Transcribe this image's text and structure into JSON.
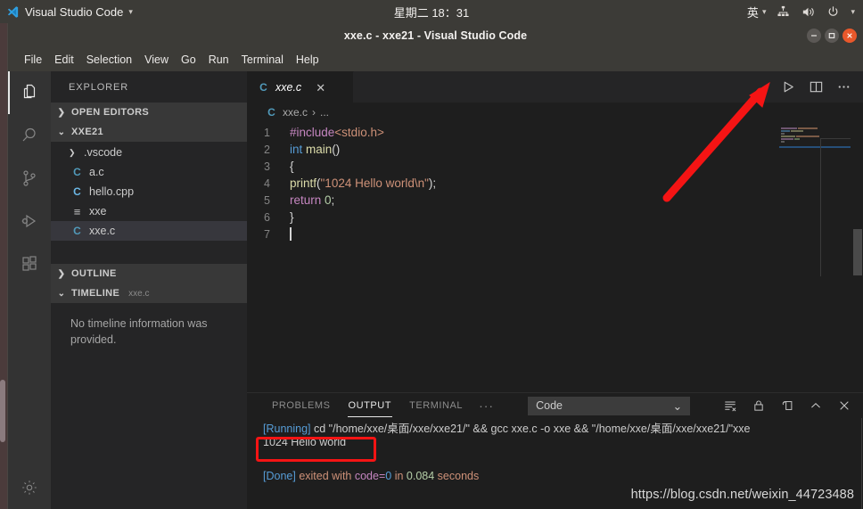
{
  "os_panel": {
    "app_name": "Visual Studio Code",
    "app_menu_caret": "▾",
    "clock": "星期二 18：31",
    "ime": "英",
    "ime_caret": "▾",
    "system_caret": "▾",
    "icons": [
      "vscode-logo-icon",
      "network-icon",
      "volume-icon",
      "power-icon"
    ]
  },
  "window": {
    "title": "xxe.c - xxe21 - Visual Studio Code",
    "controls": {
      "minimize": "minimize-button",
      "maximize": "maximize-button",
      "close": "close-button"
    }
  },
  "menubar": {
    "items": [
      "File",
      "Edit",
      "Selection",
      "View",
      "Go",
      "Run",
      "Terminal",
      "Help"
    ]
  },
  "activitybar": {
    "items": [
      {
        "name": "explorer",
        "icon": "files-icon",
        "active": true
      },
      {
        "name": "search",
        "icon": "search-icon",
        "active": false
      },
      {
        "name": "source-control",
        "icon": "source-control-icon",
        "active": false
      },
      {
        "name": "run-and-debug",
        "icon": "run-debug-icon",
        "active": false
      },
      {
        "name": "extensions",
        "icon": "extensions-icon",
        "active": false
      }
    ],
    "bottom": {
      "name": "manage",
      "icon": "gear-icon"
    }
  },
  "sidebar": {
    "title": "EXPLORER",
    "sections": [
      {
        "label": "OPEN EDITORS",
        "expanded": false,
        "twisty": "❯"
      },
      {
        "label": "XXE21",
        "expanded": true,
        "twisty": "⌄"
      }
    ],
    "tree": [
      {
        "label": ".vscode",
        "kind": "folder",
        "icon": "chevron-right-icon",
        "chev": "❯",
        "badge": "",
        "selected": false
      },
      {
        "label": "a.c",
        "kind": "file",
        "icon": "c-file-icon",
        "badge": "C",
        "selected": false
      },
      {
        "label": "hello.cpp",
        "kind": "file",
        "icon": "cpp-file-icon",
        "badge": "C",
        "selected": false
      },
      {
        "label": "xxe",
        "kind": "file",
        "icon": "binary-file-icon",
        "badge": "≡",
        "selected": false
      },
      {
        "label": "xxe.c",
        "kind": "file",
        "icon": "c-file-icon",
        "badge": "C",
        "selected": true
      }
    ],
    "outline": {
      "label": "OUTLINE",
      "twisty": "❯"
    },
    "timeline": {
      "label": "TIMELINE",
      "twisty": "⌄",
      "sub": "xxe.c",
      "empty_text": "No timeline information was provided."
    }
  },
  "editor": {
    "tab": {
      "label": "xxe.c",
      "badge": "C",
      "close": "✕"
    },
    "actions": [
      "run-code-icon",
      "split-editor-icon",
      "more-actions-icon"
    ],
    "breadcrumb": {
      "badge": "C",
      "file": "xxe.c",
      "sep": "›",
      "rest": "..."
    },
    "lines": [
      {
        "num": "1",
        "tokens": [
          {
            "t": "#include",
            "c": "t-pre"
          },
          {
            "t": "<stdio.h>",
            "c": "t-inc"
          }
        ]
      },
      {
        "num": "2",
        "tokens": [
          {
            "t": "int ",
            "c": "t-kw"
          },
          {
            "t": "main",
            "c": "t-fn"
          },
          {
            "t": "()",
            "c": "t-pun"
          }
        ]
      },
      {
        "num": "3",
        "tokens": [
          {
            "t": "{",
            "c": "t-pun"
          }
        ]
      },
      {
        "num": "4",
        "tokens": [
          {
            "t": "printf",
            "c": "t-fn"
          },
          {
            "t": "(",
            "c": "t-pun"
          },
          {
            "t": "\"1024 Hello world\\n\"",
            "c": "t-str"
          },
          {
            "t": ");",
            "c": "t-pun"
          }
        ]
      },
      {
        "num": "5",
        "tokens": [
          {
            "t": "return ",
            "c": "t-ctl"
          },
          {
            "t": "0",
            "c": "t-num"
          },
          {
            "t": ";",
            "c": "t-pun"
          }
        ]
      },
      {
        "num": "6",
        "tokens": [
          {
            "t": "}",
            "c": "t-pun"
          }
        ]
      },
      {
        "num": "7",
        "tokens": []
      }
    ]
  },
  "panel": {
    "tabs": [
      {
        "label": "PROBLEMS",
        "active": false
      },
      {
        "label": "OUTPUT",
        "active": true
      },
      {
        "label": "TERMINAL",
        "active": false
      },
      {
        "label": "···",
        "active": false,
        "dots": true
      }
    ],
    "channel": {
      "value": "Code",
      "caret": "⌄"
    },
    "actions": [
      "clear-output-icon",
      "lock-icon",
      "open-new-window-icon",
      "chevron-up-icon",
      "close-panel-icon"
    ],
    "output": [
      {
        "segments": [
          {
            "t": "[Running]",
            "c": "o-run"
          },
          {
            "t": " cd ",
            "c": "o-white"
          },
          {
            "t": "\"/home/xxe/桌面/xxe/xxe21/\"",
            "c": "o-white"
          },
          {
            "t": " && gcc xxe.c -o xxe && ",
            "c": "o-white"
          },
          {
            "t": "\"/home/xxe/桌面/xxe/xxe21/\"xxe",
            "c": "o-white"
          }
        ]
      },
      {
        "segments": [
          {
            "t": "1024 Hello world",
            "c": "o-white"
          }
        ],
        "highlighted": true
      },
      {
        "segments": []
      },
      {
        "segments": [
          {
            "t": "[Done]",
            "c": "o-done"
          },
          {
            "t": " exited with ",
            "c": "o-txt"
          },
          {
            "t": "code=",
            "c": "o-code"
          },
          {
            "t": "0",
            "c": "o-num"
          },
          {
            "t": " in ",
            "c": "o-txt"
          },
          {
            "t": "0.084",
            "c": "o-time"
          },
          {
            "t": " seconds",
            "c": "o-txt"
          }
        ]
      }
    ]
  },
  "annotations": {
    "highlight_box": {
      "name": "output-highlight-box",
      "color": "#f51414"
    },
    "arrow": {
      "name": "run-button-arrow",
      "color": "#f51414"
    },
    "watermark": "https://blog.csdn.net/weixin_44723488"
  },
  "colors": {
    "accent": "#519aba",
    "annotation": "#f51414",
    "editor_bg": "#1e1e1e",
    "sidebar_bg": "#252526",
    "titlebar_bg": "#3c3b37"
  }
}
